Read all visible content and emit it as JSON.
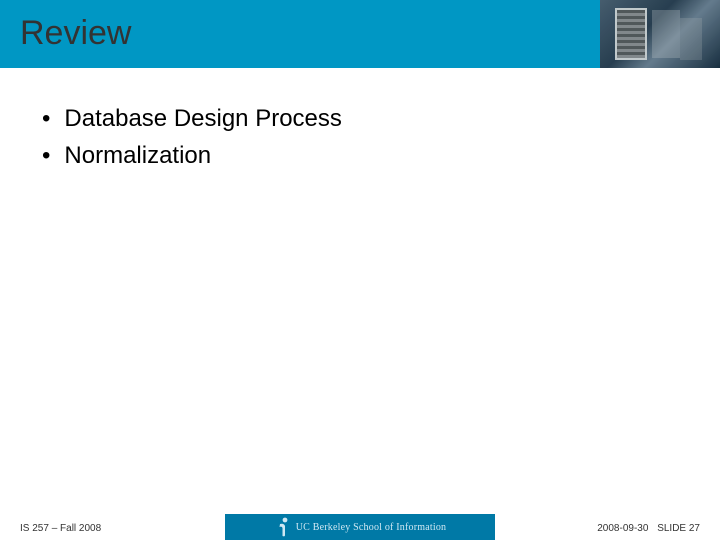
{
  "slide": {
    "title": "Review",
    "bullets": [
      "Database Design Process",
      "Normalization"
    ]
  },
  "footer": {
    "course": "IS 257 – Fall 2008",
    "institution": "UC Berkeley School of Information",
    "date": "2008-09-30",
    "slide_label": "SLIDE",
    "slide_number": "27"
  },
  "colors": {
    "header_bg": "#0097c4",
    "footer_center_bg": "#0079a6"
  }
}
